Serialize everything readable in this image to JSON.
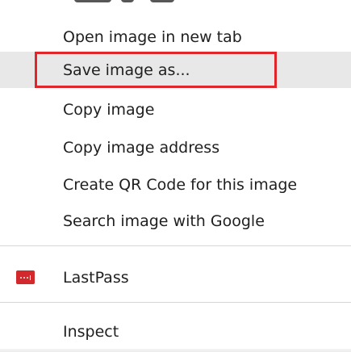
{
  "context_menu": {
    "items": [
      {
        "label": "Open image in new tab"
      },
      {
        "label": "Save image as...",
        "state": "hovered",
        "annotated": true
      },
      {
        "label": "Copy image"
      },
      {
        "label": "Copy image address"
      },
      {
        "label": "Create QR Code for this image"
      },
      {
        "label": "Search image with Google"
      }
    ],
    "extension_item": {
      "label": "LastPass",
      "icon": "lastpass-icon"
    },
    "inspect_item": {
      "label": "Inspect"
    }
  },
  "colors": {
    "hover_background": "#e8e8e8",
    "annotation_border": "#e0262a",
    "lastpass_red": "#d2292c",
    "separator": "#d6d6d6"
  }
}
